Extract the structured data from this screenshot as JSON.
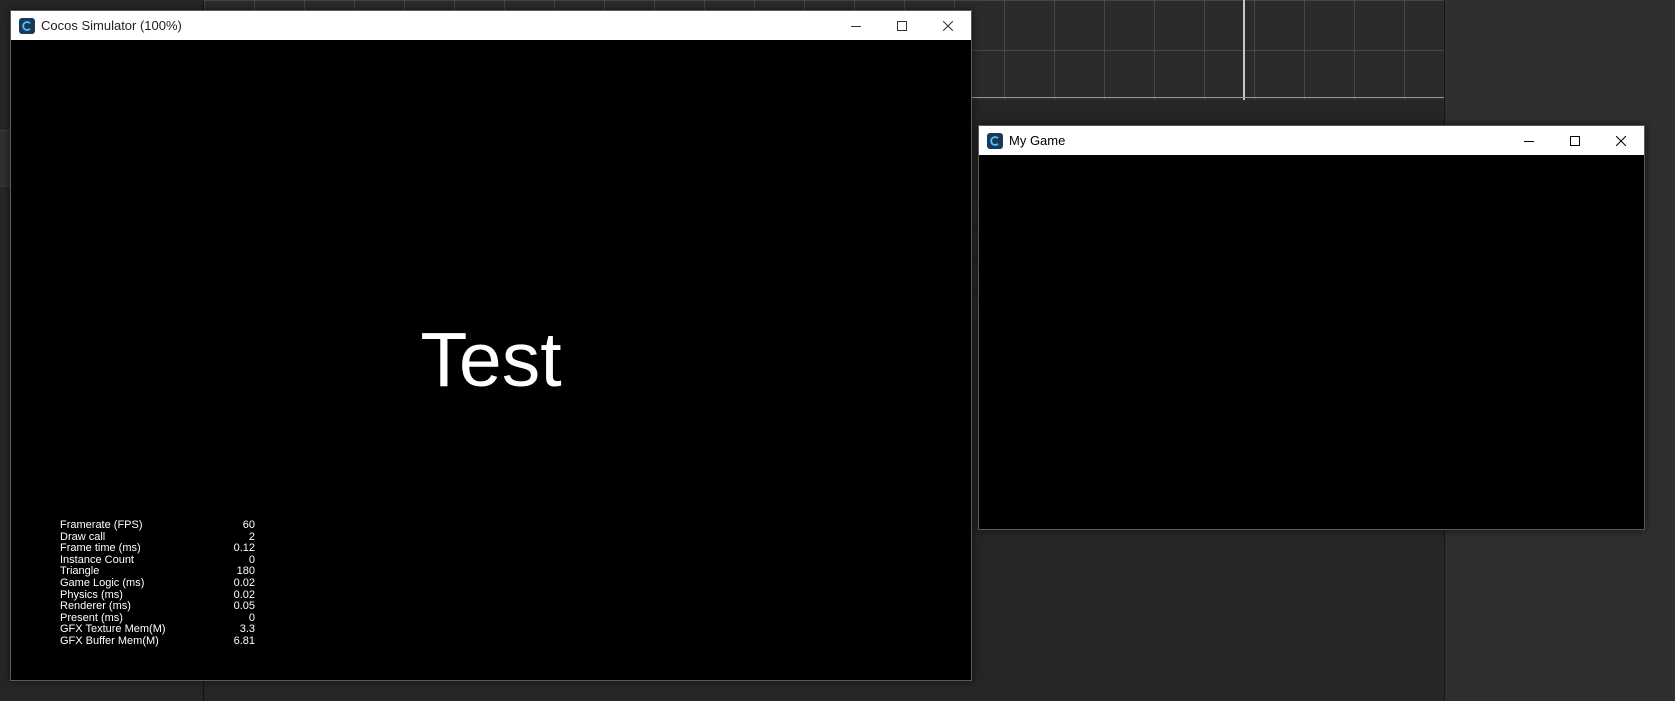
{
  "simulator_window": {
    "title": "Cocos Simulator (100%)",
    "content_text": "Test",
    "stats": [
      {
        "label": "Framerate (FPS)",
        "value": "60"
      },
      {
        "label": "Draw call",
        "value": "2"
      },
      {
        "label": "Frame time (ms)",
        "value": "0.12"
      },
      {
        "label": "Instance Count",
        "value": "0"
      },
      {
        "label": "Triangle",
        "value": "180"
      },
      {
        "label": "Game Logic (ms)",
        "value": "0.02"
      },
      {
        "label": "Physics (ms)",
        "value": "0.02"
      },
      {
        "label": "Renderer (ms)",
        "value": "0.05"
      },
      {
        "label": "Present (ms)",
        "value": "0"
      },
      {
        "label": "GFX Texture Mem(M)",
        "value": "3.3"
      },
      {
        "label": "GFX Buffer Mem(M)",
        "value": "6.81"
      }
    ]
  },
  "game_window": {
    "title": "My Game"
  },
  "icons": {
    "app": "cocos-app-icon",
    "minimize": "minimize-icon",
    "maximize": "maximize-icon",
    "close": "close-icon"
  },
  "colors": {
    "titlebar": "#ffffff",
    "viewport": "#000000",
    "editor_background": "#1c1c1c",
    "app_icon": "#1a3a5c"
  }
}
